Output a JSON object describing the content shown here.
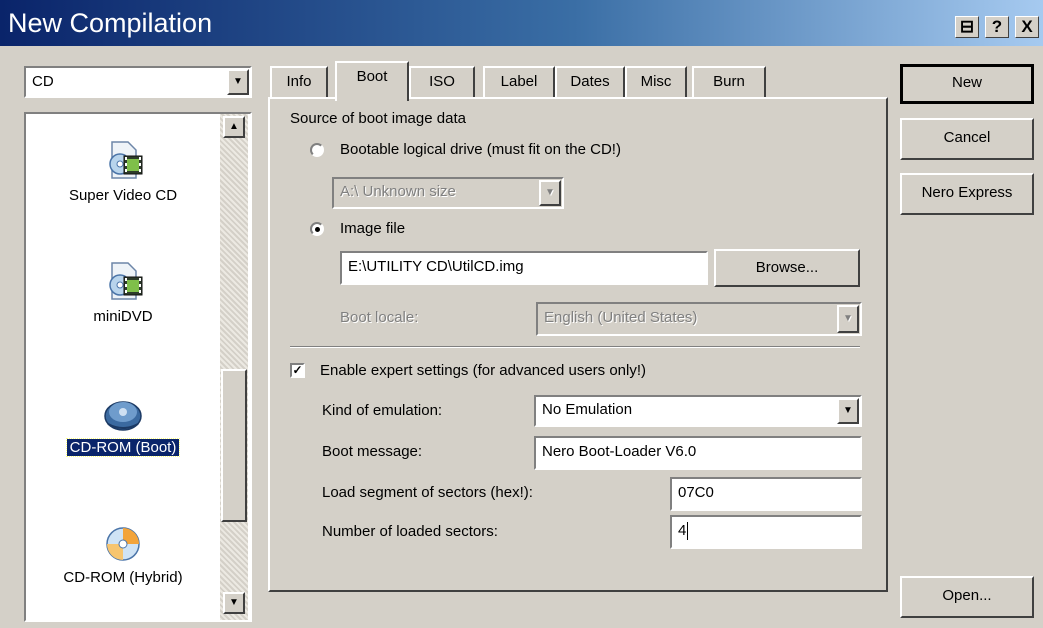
{
  "window": {
    "title": "New Compilation",
    "caption_buttons": [
      "⊟",
      "?",
      "X"
    ]
  },
  "left": {
    "media_type": "CD",
    "items": [
      {
        "label": "Super Video CD",
        "icon": "video-disc-icon"
      },
      {
        "label": "miniDVD",
        "icon": "video-disc-icon"
      },
      {
        "label": "CD-ROM (Boot)",
        "icon": "boot-disc-icon",
        "selected": true
      },
      {
        "label": "CD-ROM (Hybrid)",
        "icon": "hybrid-disc-icon"
      }
    ]
  },
  "tabs": [
    {
      "label": "Info"
    },
    {
      "label": "Boot",
      "active": true
    },
    {
      "label": "ISO"
    },
    {
      "label": "Label"
    },
    {
      "label": "Dates"
    },
    {
      "label": "Misc"
    },
    {
      "label": "Burn"
    }
  ],
  "boot": {
    "source_heading": "Source of boot image data",
    "bootable_drive_label": "Bootable logical drive (must fit on the CD!)",
    "drive_value": "A:\\  Unknown size",
    "image_file_label": "Image file",
    "image_path": "E:\\UTILITY CD\\UtilCD.img",
    "browse_label": "Browse...",
    "boot_locale_label": "Boot locale:",
    "boot_locale_value": "English (United States)",
    "expert_label": "Enable expert settings (for advanced users only!)",
    "emulation_label": "Kind of emulation:",
    "emulation_value": "No Emulation",
    "boot_message_label": "Boot message:",
    "boot_message_value": "Nero Boot-Loader V6.0",
    "load_segment_label": "Load segment of sectors (hex!):",
    "load_segment_value": "07C0",
    "loaded_sectors_label": "Number of loaded sectors:",
    "loaded_sectors_value": "4"
  },
  "buttons": {
    "new": "New",
    "cancel": "Cancel",
    "nero_express": "Nero Express",
    "open": "Open..."
  }
}
